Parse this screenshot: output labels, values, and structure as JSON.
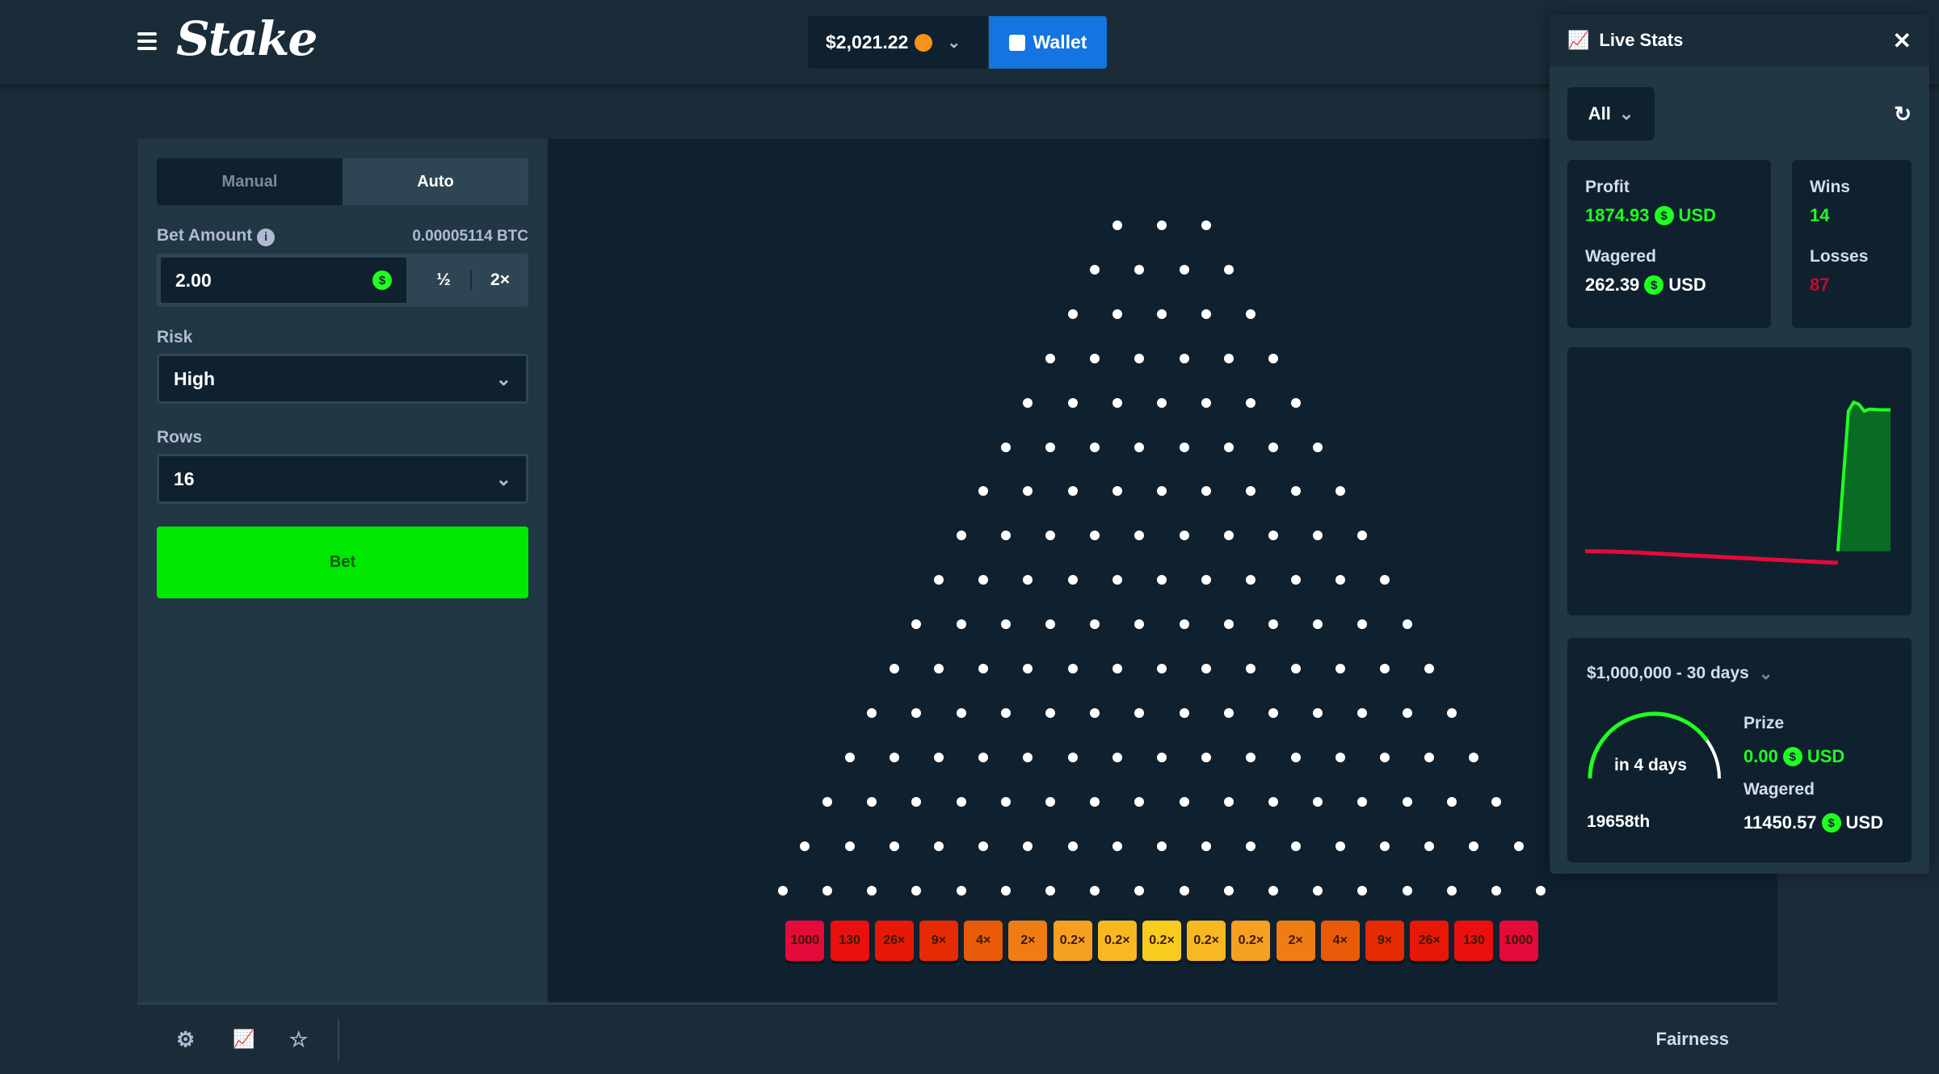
{
  "header": {
    "logo": "Stake",
    "balance": "$2,021.22",
    "wallet_label": "Wallet",
    "colors": {
      "wallet": "#1475e1"
    }
  },
  "controls": {
    "tabs": [
      {
        "label": "Manual",
        "active": false
      },
      {
        "label": "Auto",
        "active": true
      }
    ],
    "bet_amount_label": "Bet Amount",
    "bet_amount_btc": "0.00005114 BTC",
    "bet_amount_value": "2.00",
    "half_label": "½",
    "double_label": "2×",
    "risk_label": "Risk",
    "risk_value": "High",
    "rows_label": "Rows",
    "rows_value": "16",
    "bet_button": "Bet"
  },
  "board": {
    "rows": 16,
    "multipliers": [
      "1000",
      "130",
      "26×",
      "9×",
      "4×",
      "2×",
      "0.2×",
      "0.2×",
      "0.2×",
      "0.2×",
      "0.2×",
      "2×",
      "4×",
      "9×",
      "26×",
      "130",
      "1000"
    ],
    "bucket_colors": [
      "#e40a3a",
      "#ea1010",
      "#e81808",
      "#e52a04",
      "#e85a08",
      "#f07c14",
      "#f5a020",
      "#f7b822",
      "#f8cc1e",
      "#f7b822",
      "#f5a020",
      "#f07c14",
      "#e85a08",
      "#e52a04",
      "#e81808",
      "#ea1010",
      "#e40a3a"
    ]
  },
  "footer": {
    "fairness": "Fairness"
  },
  "live_stats": {
    "title": "Live Stats",
    "filter": "All",
    "profit_label": "Profit",
    "profit_value": "1874.93",
    "profit_currency": "USD",
    "wagered_label": "Wagered",
    "wagered_value": "262.39",
    "wagered_currency": "USD",
    "wins_label": "Wins",
    "wins_value": "14",
    "losses_label": "Losses",
    "losses_value": "87",
    "race_title": "$1,000,000 - 30 days",
    "race_time": "in 4 days",
    "race_progress": 0.8,
    "race_rank": "19658th",
    "prize_label": "Prize",
    "prize_value": "0.00",
    "prize_currency": "USD",
    "race_wagered_label": "Wagered",
    "race_wagered_value": "11450.57",
    "race_wagered_currency": "USD"
  },
  "chart_data": {
    "type": "area",
    "x": [
      0,
      5,
      10,
      15,
      20,
      25,
      30,
      35,
      40,
      45,
      48,
      50,
      51,
      52,
      53,
      54,
      56,
      58
    ],
    "values": [
      0,
      -5,
      -20,
      -40,
      -60,
      -80,
      -100,
      -120,
      -140,
      -160,
      -170,
      2050,
      2180,
      2150,
      2050,
      2080,
      2070,
      2070
    ],
    "colors": {
      "positive": "#1fff20",
      "negative": "#e40a3a"
    }
  }
}
